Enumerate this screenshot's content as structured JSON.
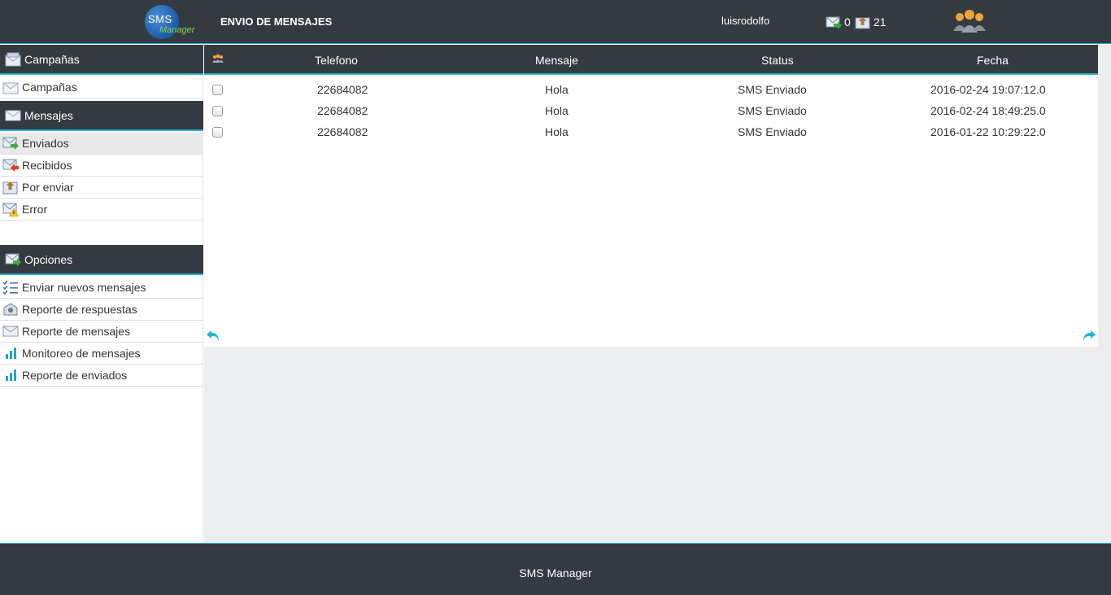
{
  "header": {
    "logo_text": "SMS",
    "logo_sub": "Manager",
    "title": "ENVIO DE MENSAJES",
    "username": "luisrodolfo",
    "sent_count": "0",
    "pending_count": "21"
  },
  "sidebar": {
    "campaigns_heading": "Campañas",
    "campaigns_item": "Campañas",
    "messages_heading": "Mensajes",
    "messages_items": [
      "Enviados",
      "Recibidos",
      "Por enviar",
      "Error"
    ],
    "options_heading": "Opciones",
    "options_items": [
      "Enviar nuevos mensajes",
      "Reporte de respuestas",
      "Reporte de mensajes",
      "Monitoreo de mensajes",
      "Reporte de enviados"
    ]
  },
  "table": {
    "columns": [
      "Telefono",
      "Mensaje",
      "Status",
      "Fecha"
    ],
    "rows": [
      [
        "22684082",
        "Hola",
        "SMS Enviado",
        "2016-02-24 19:07:12.0"
      ],
      [
        "22684082",
        "Hola",
        "SMS Enviado",
        "2016-02-24 18:49:25.0"
      ],
      [
        "22684082",
        "Hola",
        "SMS Enviado",
        "2016-01-22 10:29:22.0"
      ]
    ]
  },
  "footer": {
    "text": "SMS Manager"
  },
  "colors": {
    "dark": "#353a40",
    "accent": "#2ab3c9",
    "background": "#ecedee"
  }
}
